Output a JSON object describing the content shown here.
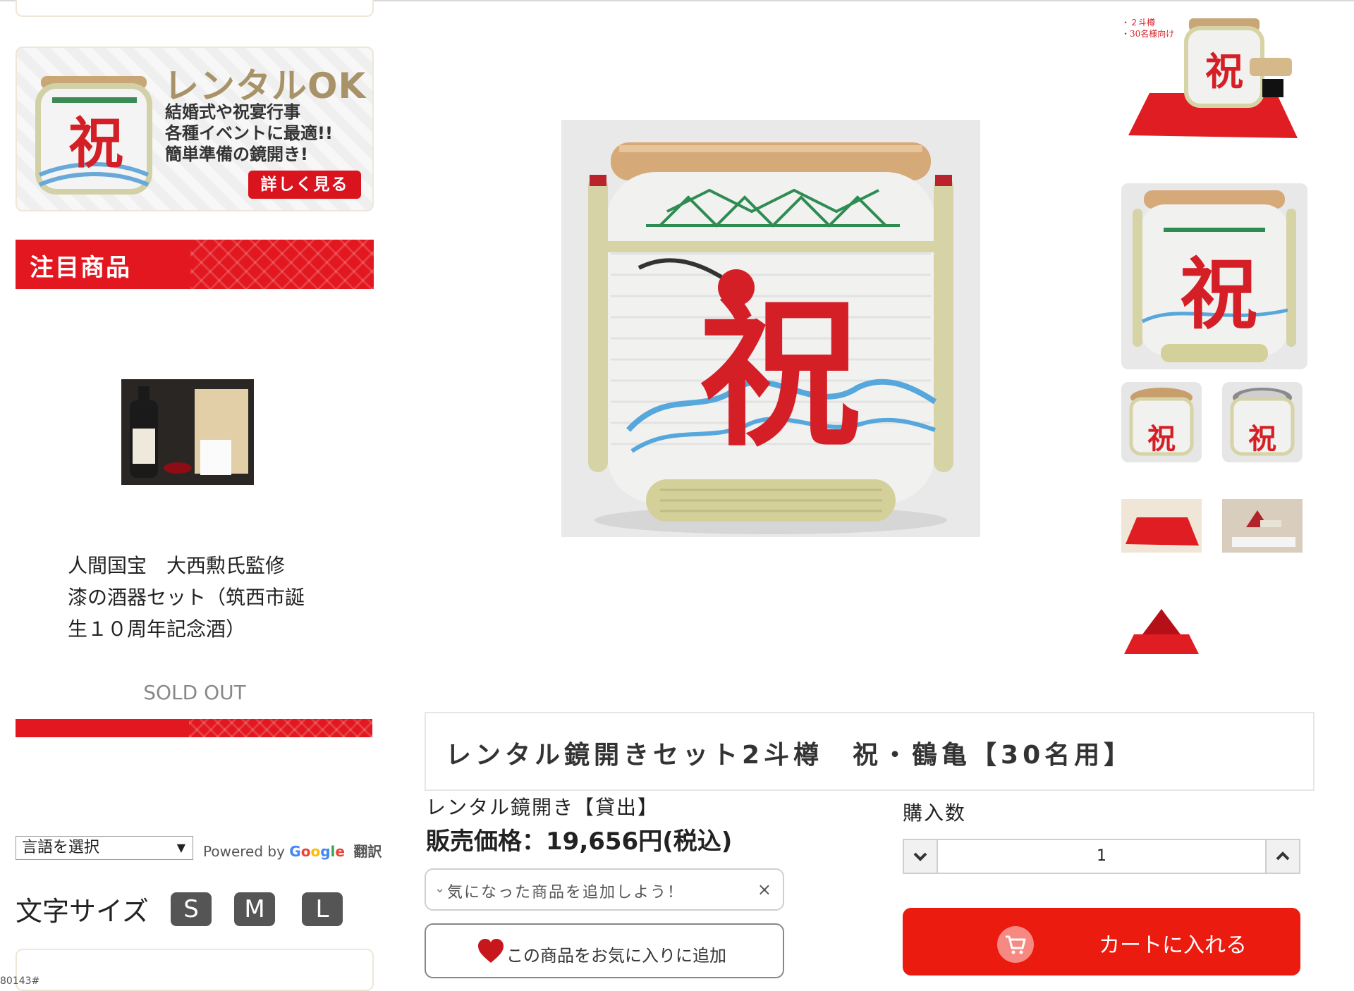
{
  "sidebar": {
    "rental_banner": {
      "headline": "レンタルOK",
      "lines": [
        "結婚式や祝宴行事",
        "各種イベントに最適!!",
        "簡単準備の鏡開き!"
      ],
      "more_label": "詳しく見る",
      "kanji": "祝"
    },
    "featured_heading": "注目商品",
    "featured_item": {
      "title": "人間国宝　大西勲氏監修　漆の酒器セット（筑西市誕生１０周年記念酒）",
      "status": "SOLD OUT"
    },
    "language_select": {
      "value": "言語を選択",
      "arrow": "▼"
    },
    "powered_by": {
      "prefix": "Powered by",
      "google": [
        "G",
        "o",
        "o",
        "g",
        "l",
        "e"
      ],
      "translate": "翻訳"
    },
    "font_size": {
      "label": "文字サイズ",
      "options": [
        "S",
        "M",
        "L"
      ]
    },
    "page_id": "80143#"
  },
  "main_image": {
    "kanji": "祝"
  },
  "thumbnails": {
    "first_caption": [
      "・２斗樽",
      "・30名様向け"
    ],
    "kanji": "祝"
  },
  "product": {
    "title": "レンタル鏡開きセット2斗樽　祝・鶴亀【30名用】",
    "category": "レンタル鏡開き【貸出】",
    "price": "販売価格：19,656円(税込)",
    "favorite_select": {
      "chevron": "⌄",
      "text": "気になった商品を追加しよう！",
      "clear": "×"
    },
    "favorite_button": "この商品をお気に入りに追加",
    "quantity": {
      "label": "購入数",
      "value": "1"
    },
    "cart_button": "カートに入れる"
  },
  "colors": {
    "accent_red": "#e3171f",
    "cart_red": "#ec1b0f",
    "gold": "#a89267"
  }
}
